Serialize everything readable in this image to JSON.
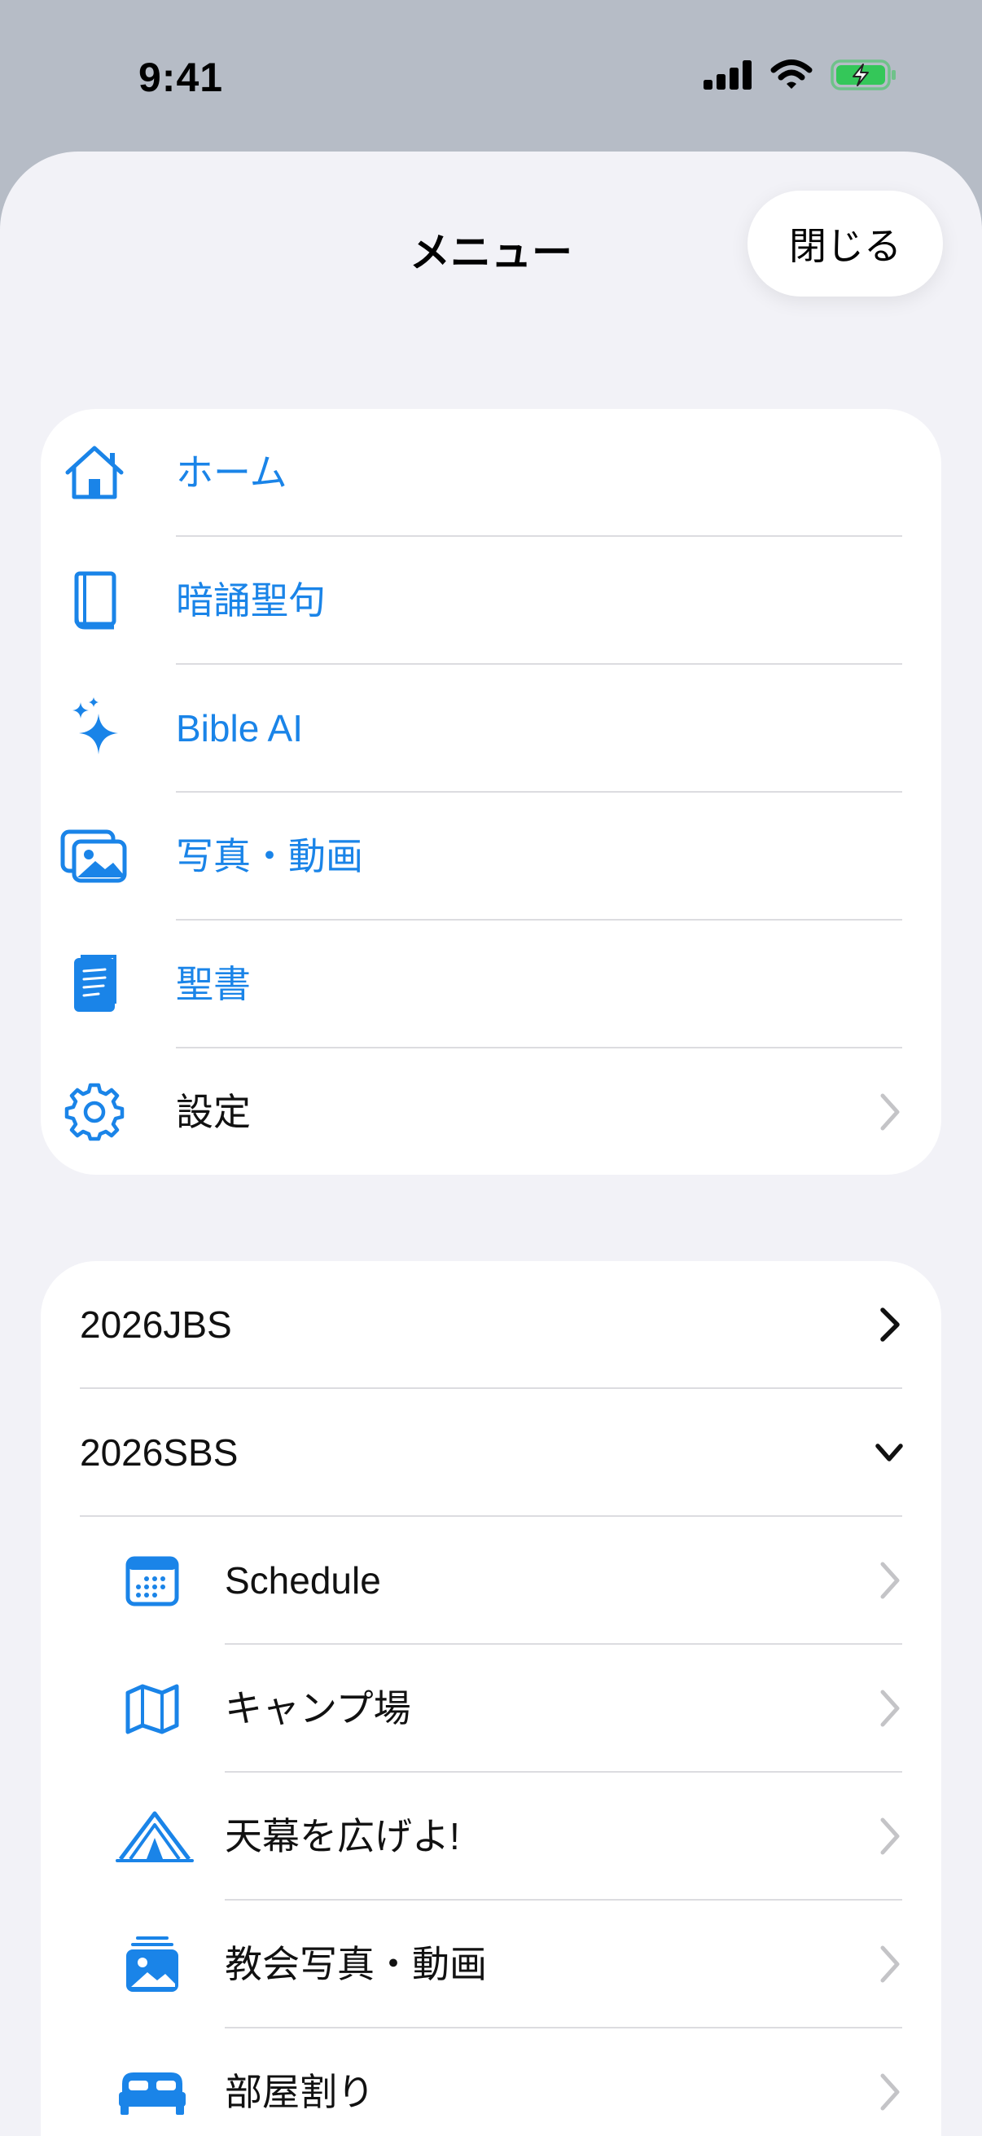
{
  "status_bar": {
    "time": "9:41"
  },
  "sheet": {
    "title": "メニュー",
    "close_label": "閉じる"
  },
  "main_menu": {
    "items": [
      {
        "label": "ホーム",
        "icon": "house-icon"
      },
      {
        "label": "暗誦聖句",
        "icon": "book-icon"
      },
      {
        "label": "Bible AI",
        "icon": "sparkles-icon"
      },
      {
        "label": "写真・動画",
        "icon": "photos-icon"
      },
      {
        "label": "聖書",
        "icon": "bible-icon"
      },
      {
        "label": "設定",
        "icon": "gear-icon"
      }
    ]
  },
  "events": {
    "groups": [
      {
        "label": "2026JBS",
        "state": "collapsed"
      },
      {
        "label": "2026SBS",
        "state": "expanded"
      }
    ],
    "sub_items": [
      {
        "label": "Schedule",
        "icon": "calendar-icon"
      },
      {
        "label": "キャンプ場",
        "icon": "map-icon"
      },
      {
        "label": "天幕を広げよ!",
        "icon": "tent-icon"
      },
      {
        "label": "教会写真・動画",
        "icon": "photo-stack-icon"
      },
      {
        "label": "部屋割り",
        "icon": "bed-icon"
      }
    ]
  },
  "colors": {
    "accent": "#1a84e8",
    "battery": "#34c759",
    "chevron": "#c4c4c7"
  }
}
